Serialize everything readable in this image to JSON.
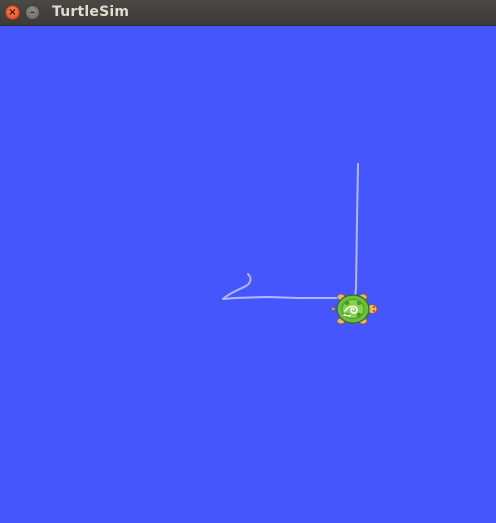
{
  "window": {
    "title": "TurtleSim",
    "close_glyph": "×",
    "minimize_glyph": "–",
    "titlebar_color": "#3c3b37",
    "close_color": "#e2491c"
  },
  "canvas": {
    "background_color": "#4556ff",
    "pen_color": "#b3b8ff"
  },
  "turtle": {
    "shell_color": "#6bbf3a",
    "icon": "turtle-icon"
  }
}
